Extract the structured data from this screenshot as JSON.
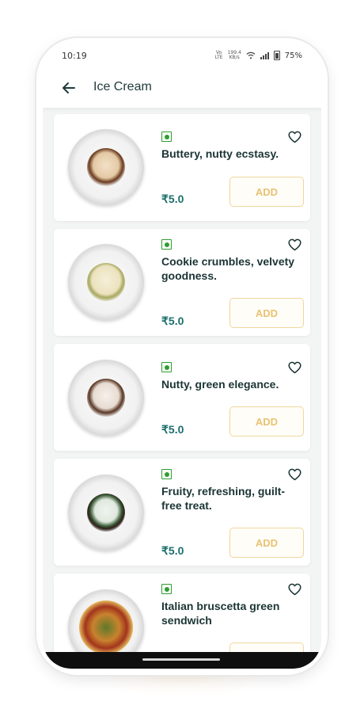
{
  "status_bar": {
    "time": "10:19",
    "net_type_top": "Vo",
    "net_type_bottom": "LTE",
    "speed_value": "199.4",
    "speed_unit": "KB/s",
    "battery": "75%"
  },
  "header": {
    "title": "Ice Cream",
    "back_icon": "arrow-left-icon"
  },
  "colors": {
    "veg": "#2e9e2e",
    "price": "#1b6f6c",
    "add_border": "#f0d79e",
    "add_text": "#e9c272"
  },
  "items": [
    {
      "name": "Buttery, nutty ecstasy.",
      "price": "₹5.0",
      "add_label": "ADD",
      "veg_icon": "veg-indicator-icon",
      "fav_icon": "heart-outline-icon"
    },
    {
      "name": "Cookie crumbles, velvety goodness.",
      "price": "₹5.0",
      "add_label": "ADD",
      "veg_icon": "veg-indicator-icon",
      "fav_icon": "heart-outline-icon"
    },
    {
      "name": "Nutty, green elegance.",
      "price": "₹5.0",
      "add_label": "ADD",
      "veg_icon": "veg-indicator-icon",
      "fav_icon": "heart-outline-icon"
    },
    {
      "name": "Fruity, refreshing, guilt-free treat.",
      "price": "₹5.0",
      "add_label": "ADD",
      "veg_icon": "veg-indicator-icon",
      "fav_icon": "heart-outline-icon"
    },
    {
      "name": "Italian bruscetta green sendwich",
      "price": "",
      "add_label": "",
      "veg_icon": "veg-indicator-icon",
      "fav_icon": "heart-outline-icon"
    }
  ]
}
